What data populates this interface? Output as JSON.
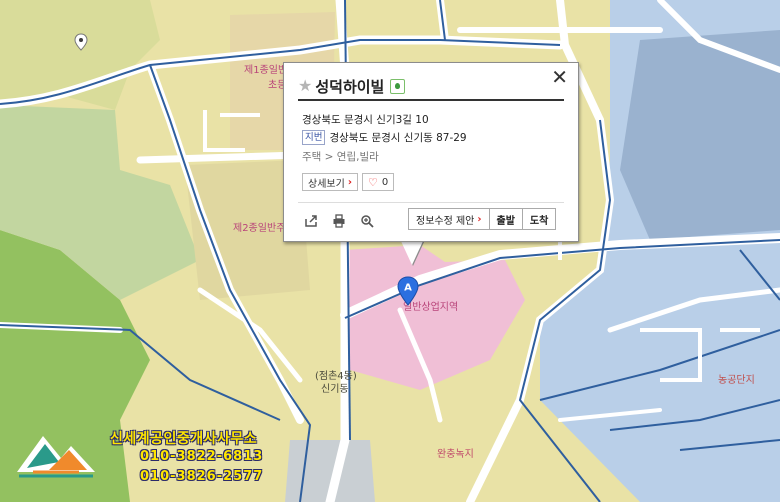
{
  "map": {
    "labels": {
      "zone1": "제1종일반",
      "zone1b": "초등",
      "zone2": "제2종일반주",
      "commercial": "일반상업지역",
      "dong_paren": "(점촌4동)",
      "dong": "신기동",
      "industrial": "농공단지",
      "green": "완충녹지"
    },
    "colors": {
      "residential": "#e9e2a6",
      "commercial": "#f0bfd6",
      "industrial": "#b9cfe8",
      "green": "#8fbf5c",
      "road": "#ffffff",
      "zone_border": "#2f5f9e"
    }
  },
  "popup": {
    "title": "성덕하이빌",
    "address": "경상북도 문경시 신기3길 10",
    "jibun_tag": "지번",
    "jibun": "경상북도 문경시 신기동 87-29",
    "category": "주택 > 연립,빌라",
    "detail_button": "상세보기",
    "like_count": "0",
    "suggest_button": "정보수정 제안",
    "depart_button": "출발",
    "arrive_button": "도착",
    "icons": [
      "share-icon",
      "print-icon",
      "zoom-icon",
      "close-icon"
    ]
  },
  "marker": {
    "letter": "A"
  },
  "branding": {
    "name": "신세계공인중개사사무소",
    "phone1": "010-3822-6813",
    "phone2": "010-3826-2577"
  }
}
